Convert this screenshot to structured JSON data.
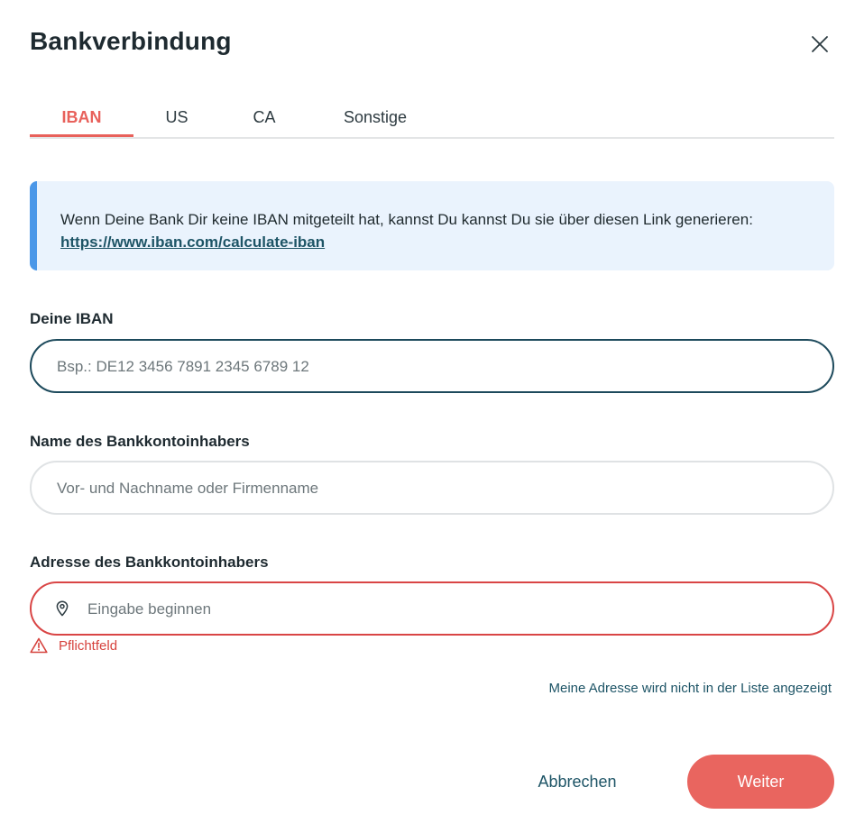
{
  "dialog": {
    "title": "Bankverbindung",
    "close_icon": "close-icon"
  },
  "tabs": [
    {
      "label": "IBAN",
      "active": true
    },
    {
      "label": "US",
      "active": false
    },
    {
      "label": "CA",
      "active": false
    },
    {
      "label": "Sonstige",
      "active": false
    }
  ],
  "info": {
    "text": "Wenn Deine Bank Dir keine IBAN mitgeteilt hat, kannst Du kannst Du sie über diesen Link generieren: ",
    "link": "https://www.iban.com/calculate-iban",
    "accent_color": "#4a97e8"
  },
  "form": {
    "iban": {
      "label": "Deine IBAN",
      "value": "",
      "placeholder": "Bsp.: DE12 3456 7891 2345 6789 12"
    },
    "name": {
      "label": "Name des Bankkontoinhabers",
      "value": "",
      "placeholder": "Vor- und Nachname oder Firmenname"
    },
    "address": {
      "label": "Adresse des Bankkontoinhabers",
      "value": "",
      "placeholder": "Eingabe beginnen",
      "icon": "location-pin-icon",
      "error_icon": "warning-icon",
      "error": "Pflichtfeld"
    },
    "address_not_listed_link": "Meine Adresse wird nicht in der Liste angezeigt"
  },
  "actions": {
    "cancel_label": "Abbrechen",
    "next_label": "Weiter"
  },
  "colors": {
    "brand": "#e9655f",
    "error": "#d6423d",
    "link": "#1d5466"
  }
}
